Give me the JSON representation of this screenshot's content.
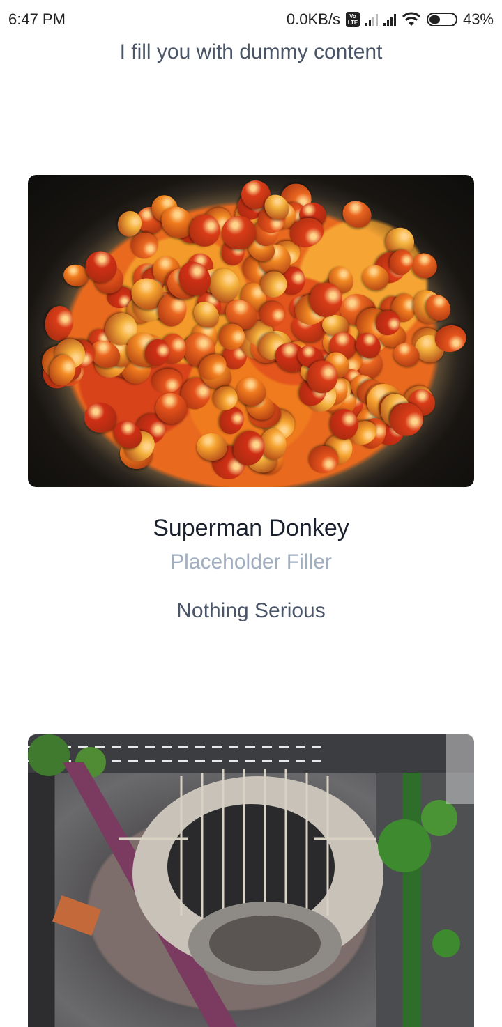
{
  "status_bar": {
    "time": "6:47 PM",
    "network_speed": "0.0KB/s",
    "volte_top": "Vo",
    "volte_bottom": "LTE",
    "battery_percent": "43%",
    "battery_level": 0.43
  },
  "header": {
    "text": "I fill you with dummy content"
  },
  "cards": [
    {
      "image_icon": "tomatoes-photo",
      "title": "Superman Donkey",
      "subtitle": "Placeholder Filler",
      "description": "Nothing Serious"
    },
    {
      "image_icon": "aerial-city-photo"
    }
  ]
}
